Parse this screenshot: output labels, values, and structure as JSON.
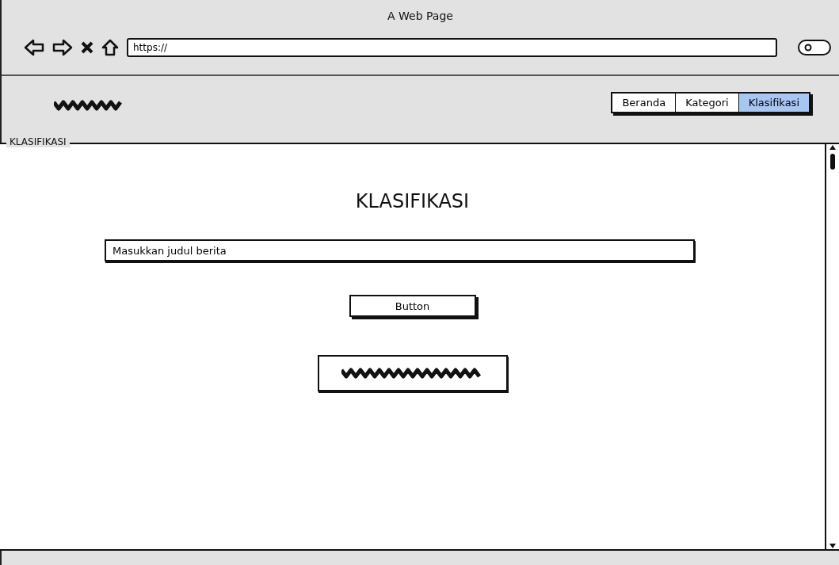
{
  "window": {
    "title": "A Web Page"
  },
  "browser": {
    "url": "https://"
  },
  "nav": {
    "tabs": [
      {
        "label": "Beranda",
        "selected": false
      },
      {
        "label": "Kategori",
        "selected": false
      },
      {
        "label": "Klasifikasi",
        "selected": true
      }
    ]
  },
  "section": {
    "legend": "KLASIFIKASI",
    "heading": "KLASIFIKASI",
    "input": {
      "value": "Masukkan judul berita"
    },
    "button": "Button"
  }
}
